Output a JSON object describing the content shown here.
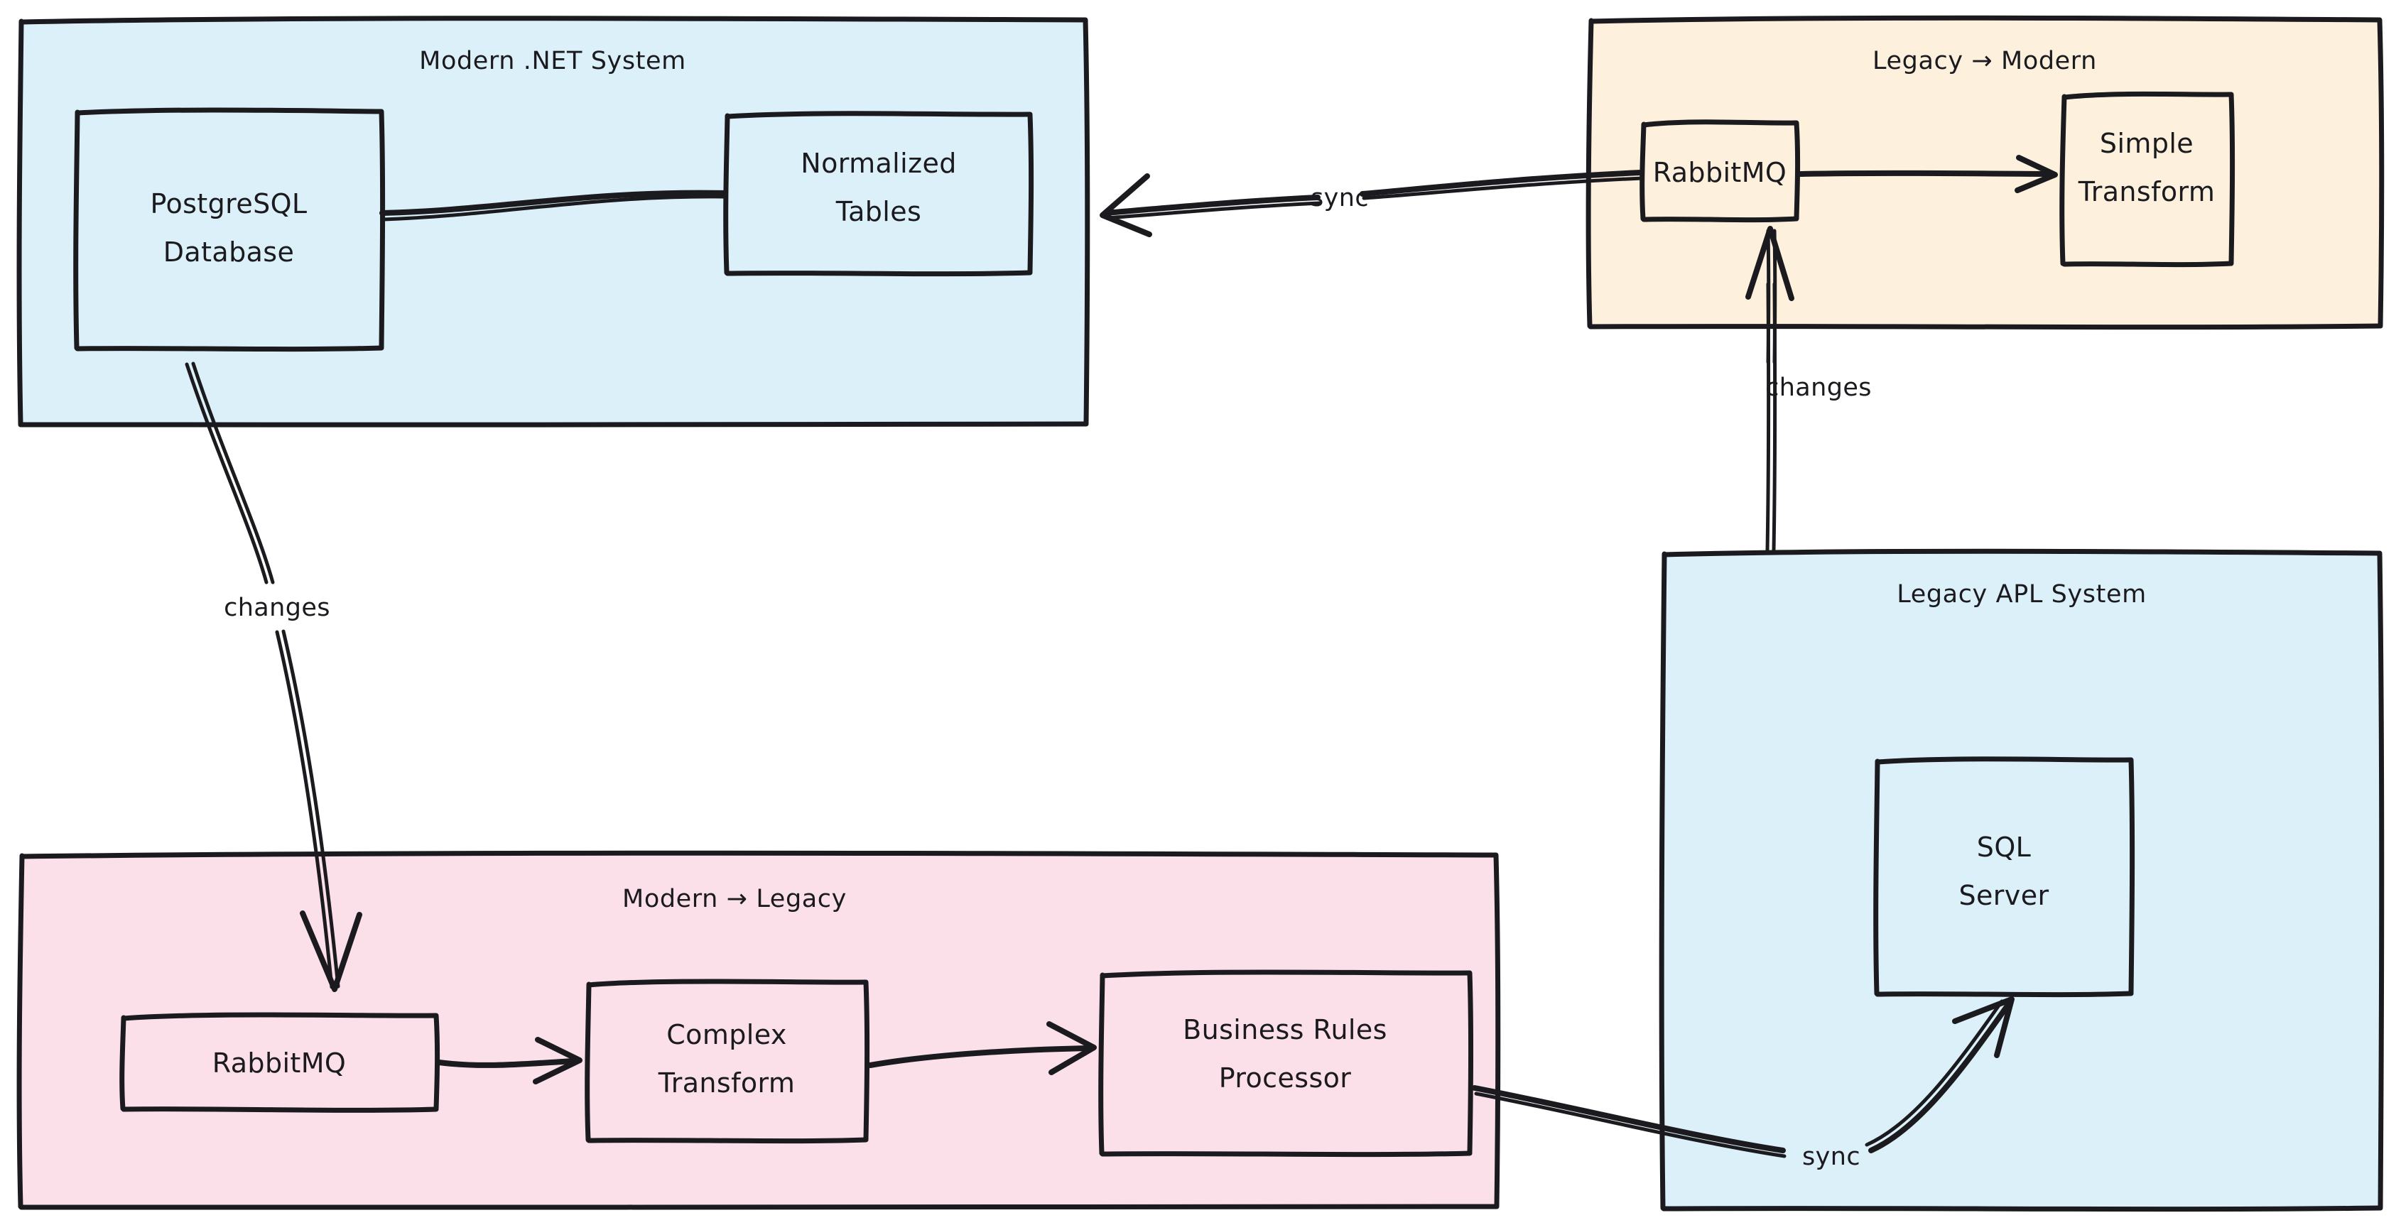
{
  "diagram": {
    "title_visible": false,
    "style": "hand-drawn sketch",
    "colors": {
      "stroke": "#1b1b1f",
      "background": "#ffffff",
      "blue_fill": "#dcf0fa",
      "orange_fill": "#fdf0dd",
      "pink_fill": "#fbe0e9"
    },
    "groups": [
      {
        "id": "modern-dotnet-system",
        "title": "Modern .NET System",
        "fill": "#dcf0fa",
        "nodes": [
          {
            "id": "postgresql-database",
            "label": "PostgreSQL\nDatabase",
            "line1": "PostgreSQL",
            "line2": "Database"
          },
          {
            "id": "normalized-tables",
            "label": "Normalized\nTables",
            "line1": "Normalized",
            "line2": "Tables"
          }
        ]
      },
      {
        "id": "legacy-to-modern",
        "title": "Legacy → Modern",
        "fill": "#fdf0dd",
        "nodes": [
          {
            "id": "rabbitmq-legacy-modern",
            "label": "RabbitMQ",
            "line1": "RabbitMQ",
            "line2": ""
          },
          {
            "id": "simple-transform",
            "label": "Simple\nTransform",
            "line1": "Simple",
            "line2": "Transform"
          }
        ]
      },
      {
        "id": "modern-to-legacy",
        "title": "Modern → Legacy",
        "fill": "#fbe0e9",
        "nodes": [
          {
            "id": "rabbitmq-modern-legacy",
            "label": "RabbitMQ",
            "line1": "RabbitMQ",
            "line2": ""
          },
          {
            "id": "complex-transform",
            "label": "Complex\nTransform",
            "line1": "Complex",
            "line2": "Transform"
          },
          {
            "id": "business-rules-processor",
            "label": "Business Rules\nProcessor",
            "line1": "Business Rules",
            "line2": "Processor"
          }
        ]
      },
      {
        "id": "legacy-apl-system",
        "title": "Legacy APL System",
        "fill": "#dcf0fa",
        "nodes": [
          {
            "id": "sql-server",
            "label": "SQL\nServer",
            "line1": "SQL",
            "line2": "Server"
          }
        ]
      }
    ],
    "edges": [
      {
        "id": "postgres-to-normalized-tables",
        "from": "postgresql-database",
        "to": "normalized-tables",
        "label": "",
        "arrowhead": false
      },
      {
        "id": "rabbitmq-legacy-modern-to-simple-transform",
        "from": "rabbitmq-legacy-modern",
        "to": "simple-transform",
        "label": "",
        "arrowhead": true
      },
      {
        "id": "legacy-modern-sync-to-modern-dotnet",
        "from": "rabbitmq-legacy-modern",
        "to": "modern-dotnet-system",
        "label": "sync",
        "arrowhead": true
      },
      {
        "id": "legacy-apl-changes-to-rabbitmq",
        "from": "legacy-apl-system",
        "to": "rabbitmq-legacy-modern",
        "label": "changes",
        "arrowhead": true
      },
      {
        "id": "postgres-changes-to-rabbitmq-modern-legacy",
        "from": "postgresql-database",
        "to": "rabbitmq-modern-legacy",
        "label": "changes",
        "arrowhead": true
      },
      {
        "id": "rabbitmq-modern-legacy-to-complex-transform",
        "from": "rabbitmq-modern-legacy",
        "to": "complex-transform",
        "label": "",
        "arrowhead": true
      },
      {
        "id": "complex-transform-to-business-rules",
        "from": "complex-transform",
        "to": "business-rules-processor",
        "label": "",
        "arrowhead": true
      },
      {
        "id": "business-rules-sync-to-sql-server",
        "from": "business-rules-processor",
        "to": "sql-server",
        "label": "sync",
        "arrowhead": true
      }
    ],
    "labels": {
      "modern_dotnet_system": "Modern .NET System",
      "legacy_to_modern": "Legacy → Modern",
      "modern_to_legacy": "Modern → Legacy",
      "legacy_apl_system": "Legacy APL System",
      "postgresql_line1": "PostgreSQL",
      "postgresql_line2": "Database",
      "normalized_line1": "Normalized",
      "normalized_line2": "Tables",
      "rabbitmq_lm": "RabbitMQ",
      "simple_line1": "Simple",
      "simple_line2": "Transform",
      "rabbitmq_ml": "RabbitMQ",
      "complex_line1": "Complex",
      "complex_line2": "Transform",
      "business_line1": "Business Rules",
      "business_line2": "Processor",
      "sql_line1": "SQL",
      "sql_line2": "Server",
      "sync_top": "sync",
      "sync_bottom": "sync",
      "changes_left": "changes",
      "changes_right": "changes"
    }
  }
}
